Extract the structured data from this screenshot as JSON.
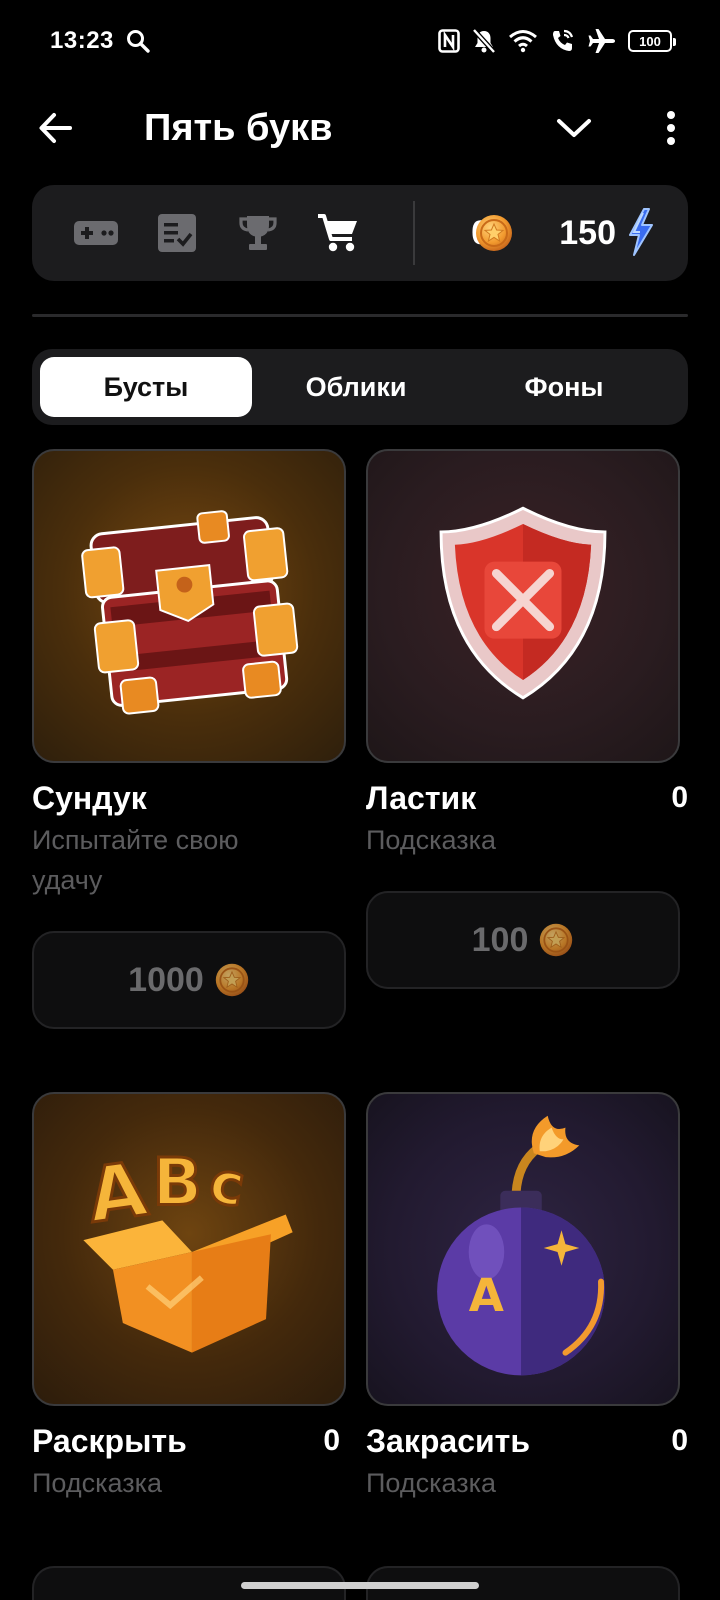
{
  "status_bar": {
    "time": "13:23",
    "battery": "100",
    "icons": [
      "search-icon",
      "nfc-icon",
      "mute-icon",
      "wifi-icon",
      "wifi-call-icon",
      "airplane-icon",
      "battery-icon"
    ]
  },
  "app_bar": {
    "title": "Пять букв",
    "icons": [
      "back-arrow-icon",
      "chevron-down-icon",
      "more-vertical-icon"
    ]
  },
  "toolbar": {
    "icons": [
      "gamepad-icon",
      "checklist-icon",
      "trophy-icon",
      "cart-icon"
    ],
    "active": "cart-icon",
    "coins": "0",
    "energy": "150"
  },
  "tabs": {
    "items": [
      "Бусты",
      "Облики",
      "Фоны"
    ],
    "active_index": 0
  },
  "items": [
    {
      "title": "Сундук",
      "subtitle": "Испытайте свою удачу",
      "quantity": "",
      "price": "1000",
      "image": "treasure-chest"
    },
    {
      "title": "Ластик",
      "subtitle": "Подсказка",
      "quantity": "0",
      "price": "100",
      "image": "shield-cross"
    },
    {
      "title": "Раскрыть",
      "subtitle": "Подсказка",
      "quantity": "0",
      "price": "",
      "image": "abc-box"
    },
    {
      "title": "Закрасить",
      "subtitle": "Подсказка",
      "quantity": "0",
      "price": "",
      "image": "letter-bomb"
    }
  ],
  "colors": {
    "background": "#000000",
    "surface": "#1c1c1e",
    "card_border": "#3a3a3c",
    "muted_text": "#5c5c5e",
    "coin": "#f0a030",
    "energy": "#3a6cf0"
  }
}
